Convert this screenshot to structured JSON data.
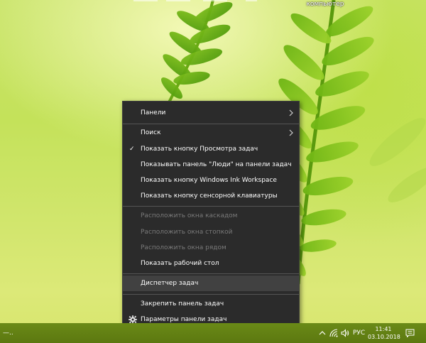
{
  "desktop": {
    "icon_label": "компьютер"
  },
  "context_menu": {
    "items": [
      {
        "label": "Панели",
        "has_submenu": true,
        "enabled": true,
        "checked": false
      },
      {
        "label": "Поиск",
        "has_submenu": true,
        "enabled": true,
        "checked": false
      },
      {
        "label": "Показать кнопку Просмотра задач",
        "has_submenu": false,
        "enabled": true,
        "checked": true
      },
      {
        "label": "Показывать панель \"Люди\" на панели задач",
        "has_submenu": false,
        "enabled": true,
        "checked": false
      },
      {
        "label": "Показать кнопку Windows Ink Workspace",
        "has_submenu": false,
        "enabled": true,
        "checked": false
      },
      {
        "label": "Показать кнопку сенсорной клавиатуры",
        "has_submenu": false,
        "enabled": true,
        "checked": false
      },
      {
        "label": "Расположить окна каскадом",
        "has_submenu": false,
        "enabled": false,
        "checked": false
      },
      {
        "label": "Расположить окна стопкой",
        "has_submenu": false,
        "enabled": false,
        "checked": false
      },
      {
        "label": "Расположить окна рядом",
        "has_submenu": false,
        "enabled": false,
        "checked": false
      },
      {
        "label": "Показать рабочий стол",
        "has_submenu": false,
        "enabled": true,
        "checked": false
      },
      {
        "label": "Диспетчер задач",
        "has_submenu": false,
        "enabled": true,
        "checked": false,
        "highlighted": true
      },
      {
        "label": "Закрепить панель задач",
        "has_submenu": false,
        "enabled": true,
        "checked": false
      },
      {
        "label": "Параметры панели задач",
        "has_submenu": false,
        "enabled": true,
        "checked": false,
        "icon": "gear-icon"
      }
    ],
    "check_glyph": "✓"
  },
  "taskbar": {
    "left_glyph": "—..",
    "language": "РУС",
    "time": "11:41",
    "date": "03.10.2018",
    "tray_icons": [
      "chevron-up-icon",
      "network-icon",
      "volume-icon",
      "notification-icon"
    ]
  },
  "colors": {
    "menu_background": "#2b2b2b",
    "menu_highlight": "#414141",
    "menu_disabled_text": "#7a7a7a",
    "taskbar": "#5d7a12"
  }
}
